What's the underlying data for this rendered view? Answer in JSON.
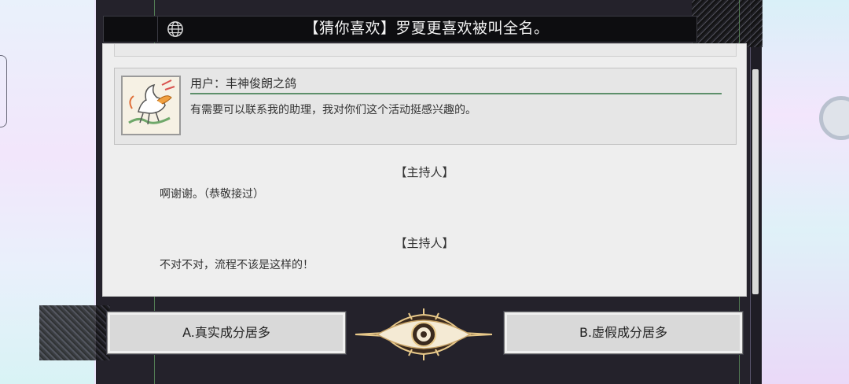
{
  "header": {
    "title": "【猜你喜欢】罗夏更喜欢被叫全名。",
    "globe_icon": "globe-icon"
  },
  "comment": {
    "avatar_icon": "pegasus-sketch-avatar",
    "username": "用户：丰神俊朗之鸽",
    "text": "有需要可以联系我的助理，我对你们这个活动挺感兴趣的。"
  },
  "dialogue": [
    {
      "speaker": "【主持人】",
      "line": "啊谢谢。（恭敬接过）"
    },
    {
      "speaker": "【主持人】",
      "line": "不对不对，流程不该是这样的！"
    }
  ],
  "choices": {
    "a_label": "A.真实成分居多",
    "b_label": "B.虚假成分居多"
  },
  "emblem": {
    "icon": "eye-emblem-icon"
  },
  "colors": {
    "accent_green": "#5d8f6a",
    "panel_bg": "#eeeeee",
    "title_bar_bg": "#0d0d10",
    "emblem_gold": "#e8c98a"
  }
}
